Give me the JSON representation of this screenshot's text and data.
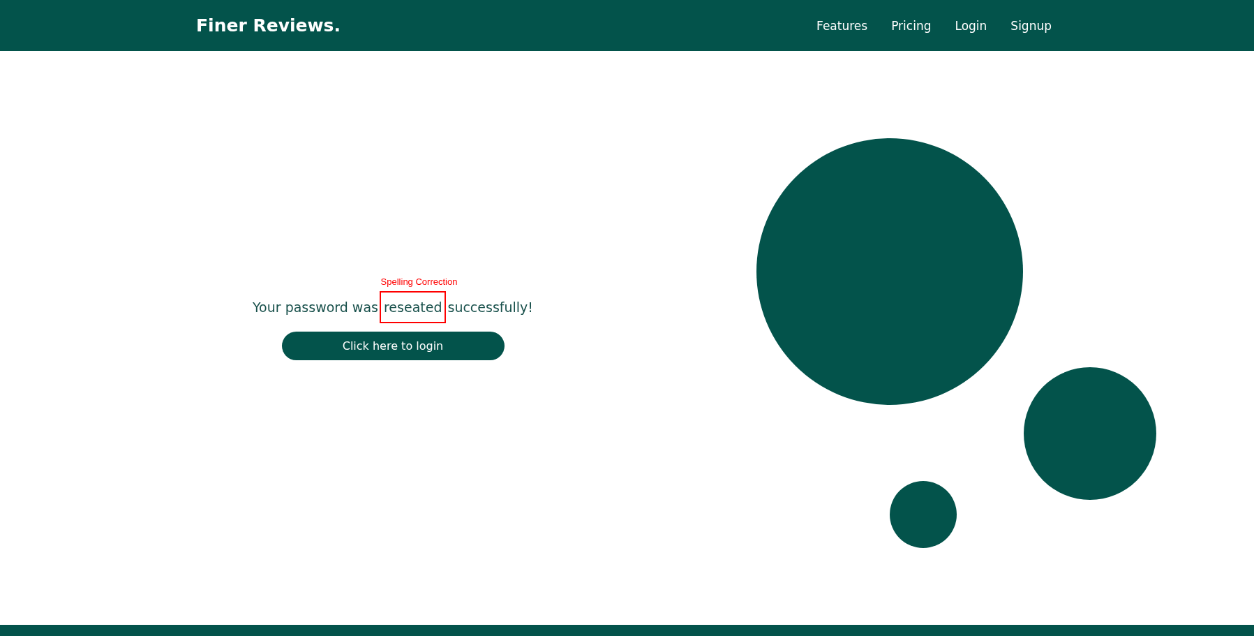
{
  "header": {
    "logo": "Finer Reviews.",
    "nav": [
      "Features",
      "Pricing",
      "Login",
      "Signup"
    ]
  },
  "message": {
    "before": "Your password was",
    "flagged_word": "reseated",
    "after": "successfully!"
  },
  "annotation": {
    "label": "Spelling Correction"
  },
  "button": {
    "label": "Click here to login"
  }
}
